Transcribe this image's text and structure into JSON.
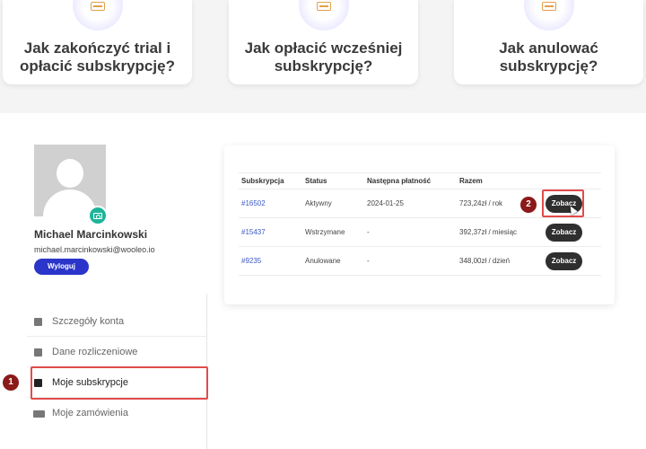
{
  "faq_cards": [
    {
      "title_line1": "Jak zakończyć trial i",
      "title_line2": "opłacić subskrypcję?"
    },
    {
      "title_line1": "Jak opłacić wcześniej",
      "title_line2": "subskrypcję?"
    },
    {
      "title_line1": "Jak anulować",
      "title_line2": "subskrypcję?"
    }
  ],
  "user": {
    "name": "Michael Marcinkowski",
    "email": "michael.marcinkowski@wooleo.io",
    "logout_label": "Wyloguj"
  },
  "nav": {
    "items": [
      {
        "label": "Szczegóły konta"
      },
      {
        "label": "Dane rozliczeniowe"
      },
      {
        "label": "Moje subskrypcje"
      },
      {
        "label": "Moje zamówienia"
      }
    ]
  },
  "table": {
    "headers": [
      "Subskrypcja",
      "Status",
      "Następna płatność",
      "Razem",
      ""
    ],
    "rows": [
      {
        "id": "#16502",
        "status": "Aktywny",
        "next": "2024-01-25",
        "total": "723,24zł / rok",
        "action": "Zobacz"
      },
      {
        "id": "#15437",
        "status": "Wstrzymane",
        "next": "-",
        "total": "392,37zł / miesiąc",
        "action": "Zobacz"
      },
      {
        "id": "#9235",
        "status": "Anulowane",
        "next": "-",
        "total": "348,00zł / dzień",
        "action": "Zobacz"
      }
    ]
  },
  "markers": {
    "m1": "1",
    "m2": "2"
  },
  "colors": {
    "accent": "#2b35c9",
    "highlight": "#e24b4b",
    "marker": "#8b1a1a",
    "teal": "#1db49a"
  }
}
